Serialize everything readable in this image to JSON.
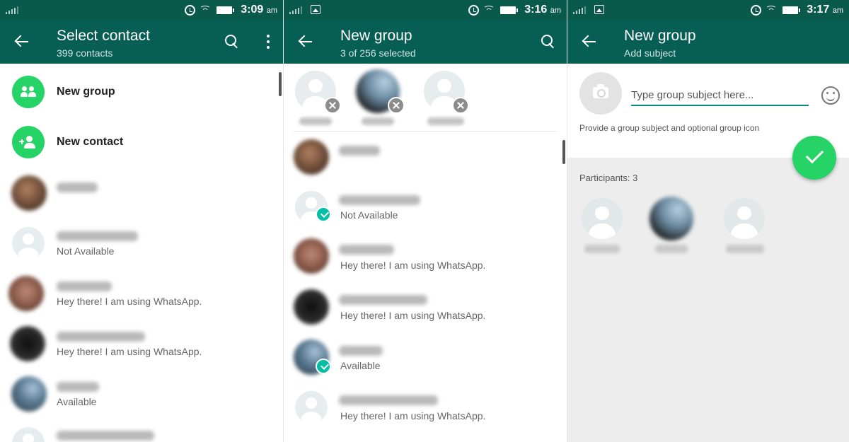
{
  "screens": [
    {
      "status": {
        "time": "3:09",
        "ampm": "am"
      },
      "header": {
        "title": "Select contact",
        "subtitle": "399 contacts"
      },
      "menu": [
        {
          "label": "New group",
          "icon": "group-icon"
        },
        {
          "label": "New contact",
          "icon": "add-person-icon"
        }
      ],
      "contacts": [
        {
          "status": ""
        },
        {
          "status": "Not Available"
        },
        {
          "status": "Hey there! I am using WhatsApp."
        },
        {
          "status": "Hey there! I am using WhatsApp."
        },
        {
          "status": "Available"
        },
        {
          "status": ""
        }
      ]
    },
    {
      "status": {
        "time": "3:16",
        "ampm": "am"
      },
      "header": {
        "title": "New group",
        "subtitle": "3 of 256 selected"
      },
      "contacts": [
        {
          "status": "",
          "selected": false
        },
        {
          "status": "Not Available",
          "selected": true
        },
        {
          "status": "Hey there! I am using WhatsApp.",
          "selected": false
        },
        {
          "status": "Hey there! I am using WhatsApp.",
          "selected": false
        },
        {
          "status": "Available",
          "selected": true
        },
        {
          "status": "Hey there! I am using WhatsApp.",
          "selected": false
        }
      ]
    },
    {
      "status": {
        "time": "3:17",
        "ampm": "am"
      },
      "header": {
        "title": "New group",
        "subtitle": "Add subject"
      },
      "subject": {
        "placeholder": "Type group subject here...",
        "value": ""
      },
      "hint": "Provide a group subject and optional group icon",
      "participants_label": "Participants: 3"
    }
  ],
  "colors": {
    "header": "#075e54",
    "statusbar": "#0a5a4c",
    "accent": "#25d366",
    "check": "#00bfa5"
  }
}
